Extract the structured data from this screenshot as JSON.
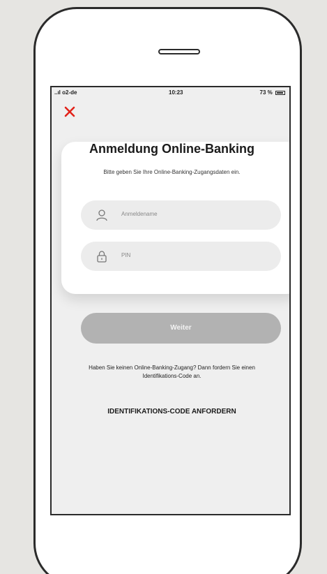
{
  "status_bar": {
    "carrier": "..ıl o2-de",
    "time": "10:23",
    "battery": "73 %"
  },
  "login": {
    "title": "Anmeldung Online-Banking",
    "subtitle": "Bitte geben Sie Ihre Online-Banking-Zugangsdaten ein.",
    "username_placeholder": "Anmeldename",
    "pin_placeholder": "PIN"
  },
  "actions": {
    "continue_label": "Weiter",
    "info_text": "Haben Sie keinen Online-Banking-Zugang? Dann fordern Sie einen Identifikations-Code an.",
    "request_code_label": "IDENTIFIKATIONS-CODE ANFORDERN"
  },
  "colors": {
    "close_icon": "#e2231a",
    "button_disabled": "#b2b2b2",
    "field_bg": "#ececec"
  },
  "icons": {
    "close": "close-icon",
    "user": "user-icon",
    "lock": "lock-icon"
  }
}
